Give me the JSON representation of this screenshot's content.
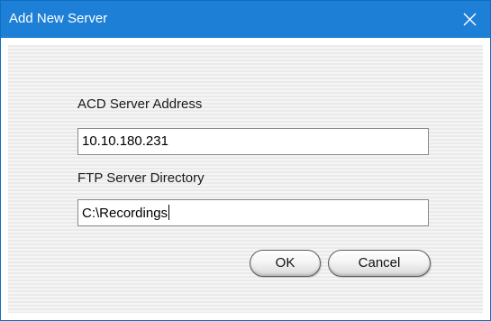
{
  "window": {
    "title": "Add New Server",
    "close_icon": "close-icon"
  },
  "form": {
    "acd_label": "ACD Server Address",
    "acd_value": "10.10.180.231",
    "ftp_label": "FTP Server Directory",
    "ftp_value": "C:\\Recordings"
  },
  "buttons": {
    "ok_label": "OK",
    "cancel_label": "Cancel"
  },
  "colors": {
    "titlebar": "#1e7fd6",
    "window_border": "#0a6fc2",
    "title_text": "#ffffff"
  }
}
